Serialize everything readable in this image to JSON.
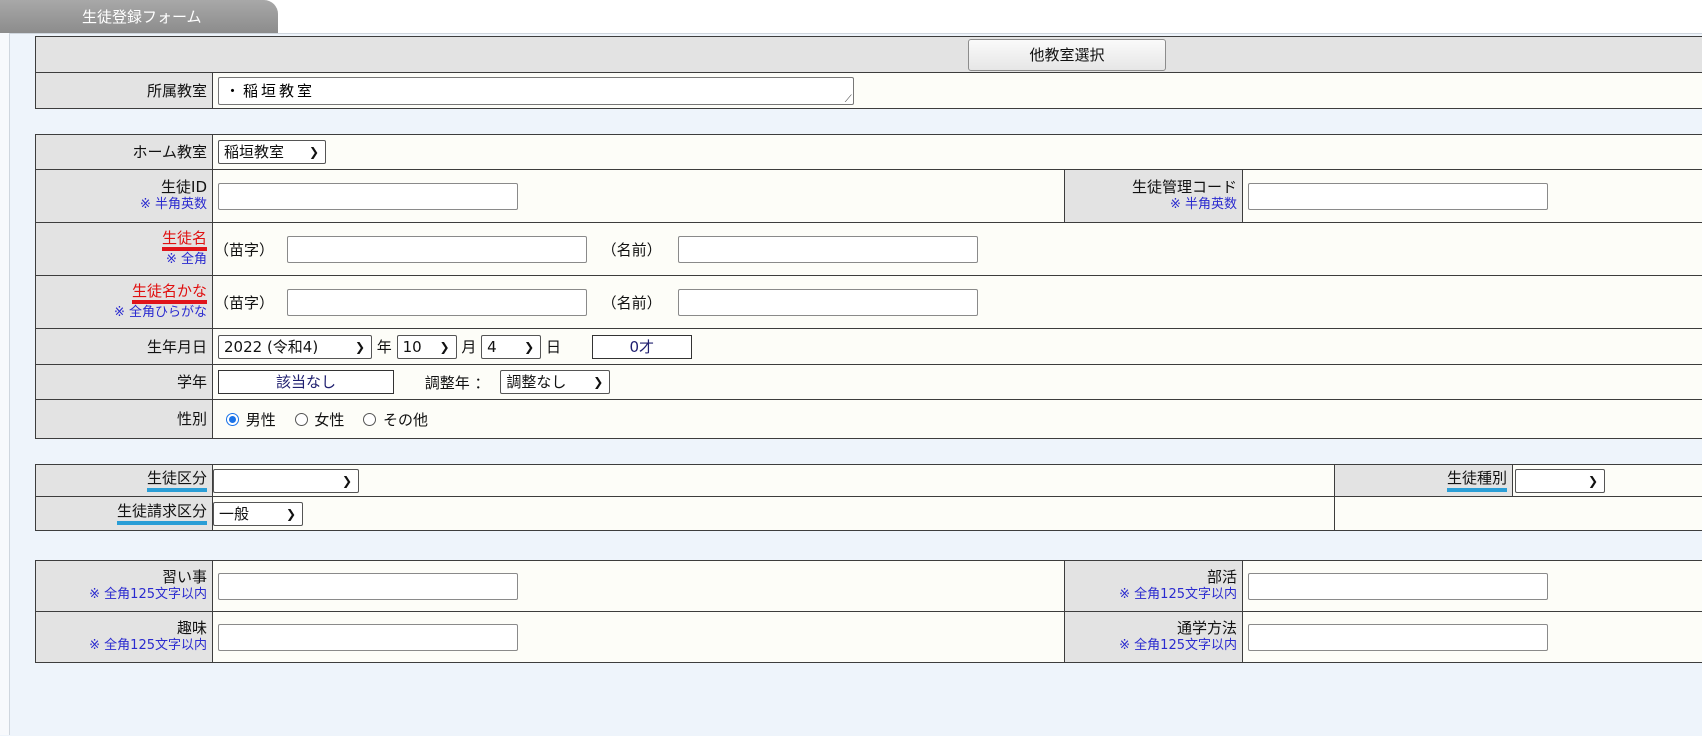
{
  "tab_title": "生徒登録フォーム",
  "classroom": {
    "other_button": "他教室選択",
    "label": "所属教室",
    "value": "・稲垣教室"
  },
  "basic": {
    "home_classroom": {
      "label": "ホーム教室",
      "value": "稲垣教室"
    },
    "student_id": {
      "label": "生徒ID",
      "note": "※ 半角英数",
      "value": ""
    },
    "student_code": {
      "label": "生徒管理コード",
      "note": "※ 半角英数",
      "value": ""
    },
    "name": {
      "label": "生徒名",
      "note": "※ 全角",
      "surname_label": "（苗字）",
      "given_label": "（名前）"
    },
    "kana": {
      "label": "生徒名かな",
      "note": "※ 全角ひらがな",
      "surname_label": "（苗字）",
      "given_label": "（名前）"
    },
    "birthday": {
      "label": "生年月日",
      "year": "2022 (令和4)",
      "year_unit": "年",
      "month": "10",
      "month_unit": "月",
      "day": "4",
      "day_unit": "日",
      "age": "0才"
    },
    "grade": {
      "label": "学年",
      "value": "該当なし",
      "adjust_label": "調整年 ：",
      "adjust_value": "調整なし"
    },
    "gender": {
      "label": "性別",
      "options": [
        "男性",
        "女性",
        "その他"
      ],
      "selected": "男性"
    }
  },
  "category": {
    "kubun_label": "生徒区分",
    "kubun_value": "",
    "shubetsu_label": "生徒種別",
    "shubetsu_value": "",
    "billing_label": "生徒請求区分",
    "billing_value": "一般"
  },
  "extra": {
    "lessons": {
      "label": "習い事",
      "note": "※ 全角125文字以内"
    },
    "club": {
      "label": "部活",
      "note": "※ 全角125文字以内"
    },
    "hobby": {
      "label": "趣味",
      "note": "※ 全角125文字以内"
    },
    "commute": {
      "label": "通学方法",
      "note": "※ 全角125文字以内"
    }
  },
  "colors": {
    "required_label": "#e01010",
    "underline_red": "#e0141a",
    "underline_blue": "#2a9ed6",
    "note_text": "#2a2acf"
  },
  "icons": {
    "dropdown": "chevron-down-icon",
    "resize": "resize-grip-icon"
  }
}
